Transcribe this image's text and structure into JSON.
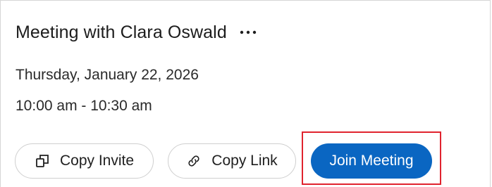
{
  "meeting": {
    "title": "Meeting with Clara Oswald",
    "more_icon": "more-horizontal-icon",
    "date": "Thursday, January 22, 2026",
    "time": "10:00 am - 10:30 am"
  },
  "actions": {
    "copy_invite_label": "Copy Invite",
    "copy_invite_icon": "copy-icon",
    "copy_link_label": "Copy Link",
    "copy_link_icon": "link-icon",
    "join_label": "Join Meeting"
  },
  "colors": {
    "join_button": "#0a66c2",
    "highlight": "#e0232e"
  }
}
